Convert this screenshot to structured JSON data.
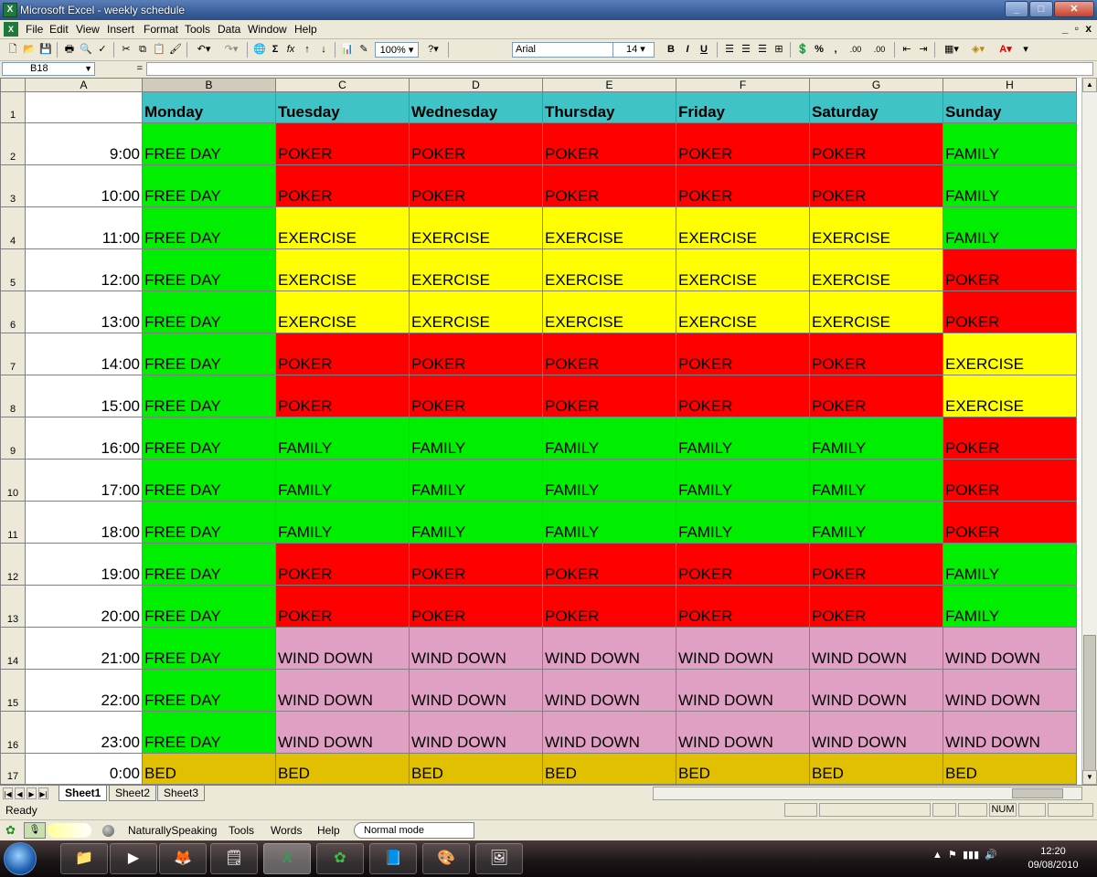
{
  "window": {
    "title": "Microsoft Excel - weekly schedule",
    "minimize": "_",
    "maximize": "□",
    "close": "✕"
  },
  "menu": {
    "items": [
      "File",
      "Edit",
      "View",
      "Insert",
      "Format",
      "Tools",
      "Data",
      "Window",
      "Help"
    ],
    "mdi_controls": "_ 𝗓 x"
  },
  "toolbar": {
    "zoom": "100%",
    "font_name": "Arial",
    "font_size": "14",
    "bold": "B",
    "italic": "I",
    "underline": "U",
    "percent": "%",
    "comma": ",",
    "inc_decimal": ".00",
    "dec_decimal": ".00",
    "autosum": "Σ",
    "fx": "fx"
  },
  "formula_bar": {
    "cell_ref": "B18",
    "equals": "=",
    "value": ""
  },
  "sheet": {
    "col_headers": [
      "A",
      "B",
      "C",
      "D",
      "E",
      "F",
      "G",
      "H"
    ],
    "days": [
      "Monday",
      "Tuesday",
      "Wednesday",
      "Thursday",
      "Friday",
      "Saturday",
      "Sunday"
    ],
    "colors": {
      "FREE DAY": "#00ee00",
      "POKER": "#ff0000",
      "FAMILY": "#00ee00",
      "EXERCISE": "#ffff00",
      "WIND DOWN": "#e0a0c4",
      "BED": "#e0c000"
    },
    "rows": [
      {
        "n": "2",
        "time": "9:00",
        "cells": [
          "FREE DAY",
          "POKER",
          "POKER",
          "POKER",
          "POKER",
          "POKER",
          "FAMILY"
        ]
      },
      {
        "n": "3",
        "time": "10:00",
        "cells": [
          "FREE DAY",
          "POKER",
          "POKER",
          "POKER",
          "POKER",
          "POKER",
          "FAMILY"
        ]
      },
      {
        "n": "4",
        "time": "11:00",
        "cells": [
          "FREE DAY",
          "EXERCISE",
          "EXERCISE",
          "EXERCISE",
          "EXERCISE",
          "EXERCISE",
          "FAMILY"
        ]
      },
      {
        "n": "5",
        "time": "12:00",
        "cells": [
          "FREE DAY",
          "EXERCISE",
          "EXERCISE",
          "EXERCISE",
          "EXERCISE",
          "EXERCISE",
          "POKER"
        ]
      },
      {
        "n": "6",
        "time": "13:00",
        "cells": [
          "FREE DAY",
          "EXERCISE",
          "EXERCISE",
          "EXERCISE",
          "EXERCISE",
          "EXERCISE",
          "POKER"
        ]
      },
      {
        "n": "7",
        "time": "14:00",
        "cells": [
          "FREE DAY",
          "POKER",
          "POKER",
          "POKER",
          "POKER",
          "POKER",
          "EXERCISE"
        ]
      },
      {
        "n": "8",
        "time": "15:00",
        "cells": [
          "FREE DAY",
          "POKER",
          "POKER",
          "POKER",
          "POKER",
          "POKER",
          "EXERCISE"
        ]
      },
      {
        "n": "9",
        "time": "16:00",
        "cells": [
          "FREE DAY",
          "FAMILY",
          "FAMILY",
          "FAMILY",
          "FAMILY",
          "FAMILY",
          "POKER"
        ]
      },
      {
        "n": "10",
        "time": "17:00",
        "cells": [
          "FREE DAY",
          "FAMILY",
          "FAMILY",
          "FAMILY",
          "FAMILY",
          "FAMILY",
          "POKER"
        ]
      },
      {
        "n": "11",
        "time": "18:00",
        "cells": [
          "FREE DAY",
          "FAMILY",
          "FAMILY",
          "FAMILY",
          "FAMILY",
          "FAMILY",
          "POKER"
        ]
      },
      {
        "n": "12",
        "time": "19:00",
        "cells": [
          "FREE DAY",
          "POKER",
          "POKER",
          "POKER",
          "POKER",
          "POKER",
          "FAMILY"
        ]
      },
      {
        "n": "13",
        "time": "20:00",
        "cells": [
          "FREE DAY",
          "POKER",
          "POKER",
          "POKER",
          "POKER",
          "POKER",
          "FAMILY"
        ]
      },
      {
        "n": "14",
        "time": "21:00",
        "cells": [
          "FREE DAY",
          "WIND DOWN",
          "WIND DOWN",
          "WIND DOWN",
          "WIND DOWN",
          "WIND DOWN",
          "WIND DOWN"
        ]
      },
      {
        "n": "15",
        "time": "22:00",
        "cells": [
          "FREE DAY",
          "WIND DOWN",
          "WIND DOWN",
          "WIND DOWN",
          "WIND DOWN",
          "WIND DOWN",
          "WIND DOWN"
        ]
      },
      {
        "n": "16",
        "time": "23:00",
        "cells": [
          "FREE DAY",
          "WIND DOWN",
          "WIND DOWN",
          "WIND DOWN",
          "WIND DOWN",
          "WIND DOWN",
          "WIND DOWN"
        ]
      },
      {
        "n": "17",
        "time": "0:00",
        "cells": [
          "BED",
          "BED",
          "BED",
          "BED",
          "BED",
          "BED",
          "BED"
        ]
      }
    ]
  },
  "tabs": [
    "Sheet1",
    "Sheet2",
    "Sheet3"
  ],
  "status": {
    "text": "Ready",
    "num": "NUM"
  },
  "dragon": {
    "items": [
      "NaturallySpeaking",
      "Tools",
      "Words",
      "Help"
    ],
    "mode": "Normal mode"
  },
  "taskbar": {
    "time": "12:20",
    "date": "09/08/2010"
  }
}
